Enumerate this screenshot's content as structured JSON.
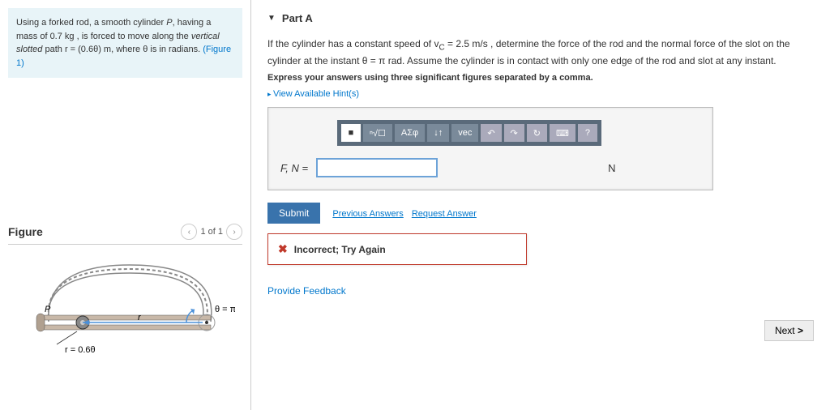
{
  "problem": {
    "text_part1": "Using a forked rod, a smooth cylinder ",
    "var_P": "P",
    "text_part2": ", having a mass of 0.7 kg , is forced to move along the ",
    "emphasis": "vertical slotted",
    "text_part3": " path r = (0.6θ) m, where θ is in radians. ",
    "figure_link": "(Figure 1)"
  },
  "figure": {
    "title": "Figure",
    "pager": "1 of 1",
    "label_P": "P",
    "label_r": "r",
    "label_theta": "θ = π",
    "label_req": "r = 0.6θ"
  },
  "part": {
    "label": "Part A",
    "question1": "If the cylinder has a constant speed of v",
    "sub_c": "C",
    "question2": " = 2.5 m/s , determine the force of the rod and the normal force of the slot on the cylinder at the instant θ = π rad. Assume the cylinder is in contact with only one edge of the rod and slot at any instant.",
    "express": "Express your answers using three significant figures separated by a comma.",
    "hints": "View Available Hint(s)"
  },
  "toolbar": {
    "t1": "■",
    "t2": "ⁿ√☐",
    "t3": "ΑΣφ",
    "t4": "↓↑",
    "t5": "vec",
    "t6": "↶",
    "t7": "↷",
    "t8": "↻",
    "t9": "⌨",
    "t10": "?"
  },
  "input": {
    "label": "F, N =",
    "unit": "N"
  },
  "actions": {
    "submit": "Submit",
    "prev_answers": "Previous Answers",
    "request": "Request Answer"
  },
  "feedback": {
    "icon": "✖",
    "text": "Incorrect; Try Again"
  },
  "footer": {
    "provide": "Provide Feedback",
    "next": "Next"
  }
}
